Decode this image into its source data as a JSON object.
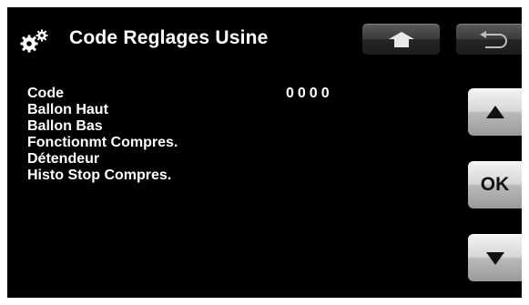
{
  "header": {
    "title": "Code Reglages Usine",
    "icon": "gears-icon"
  },
  "toolbar": {
    "home_icon": "up-arrow-icon",
    "back_icon": "return-arrow-icon"
  },
  "menu": {
    "items": [
      {
        "label": "Code",
        "value": "0000"
      },
      {
        "label": "Ballon Haut"
      },
      {
        "label": "Ballon Bas"
      },
      {
        "label": "Fonctionmt Compres."
      },
      {
        "label": "Détendeur"
      },
      {
        "label": "Histo Stop Compres."
      }
    ]
  },
  "side_buttons": {
    "up_icon": "triangle-up-icon",
    "ok_label": "OK",
    "down_icon": "triangle-down-icon"
  },
  "colors": {
    "background": "#000000",
    "text": "#ffffff",
    "dark_button": "#3a3a3a",
    "light_button": "#d0d0d0"
  }
}
